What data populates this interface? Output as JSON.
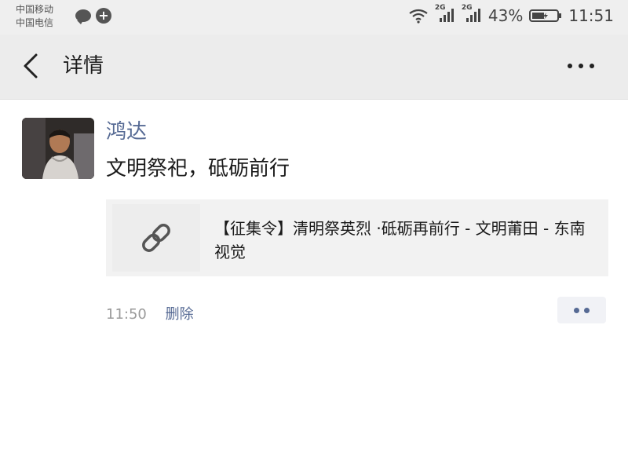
{
  "status_bar": {
    "carrier_1": "中国移动",
    "carrier_2": "中国电信",
    "network_1": "2G",
    "network_2": "2G",
    "battery": "43%",
    "time": "11:51",
    "icons": [
      "message-icon",
      "plus-circle-icon",
      "wifi-icon",
      "signal-icon",
      "battery-icon"
    ]
  },
  "header": {
    "title": "详情",
    "back_icon": "chevron-left-icon",
    "more_icon": "more-dots-icon"
  },
  "post": {
    "author": "鸿达",
    "text": "文明祭祀，砥砺前行",
    "link": {
      "icon": "link-icon",
      "title": "【征集令】清明祭英烈 ·砥砺再前行 - 文明莆田 - 东南视觉"
    },
    "time": "11:50",
    "delete_label": "删除",
    "comment_icon": "comment-dots-icon"
  },
  "colors": {
    "accent": "#566a94",
    "nav_background": "#ececec",
    "card_background": "#f2f2f2"
  }
}
